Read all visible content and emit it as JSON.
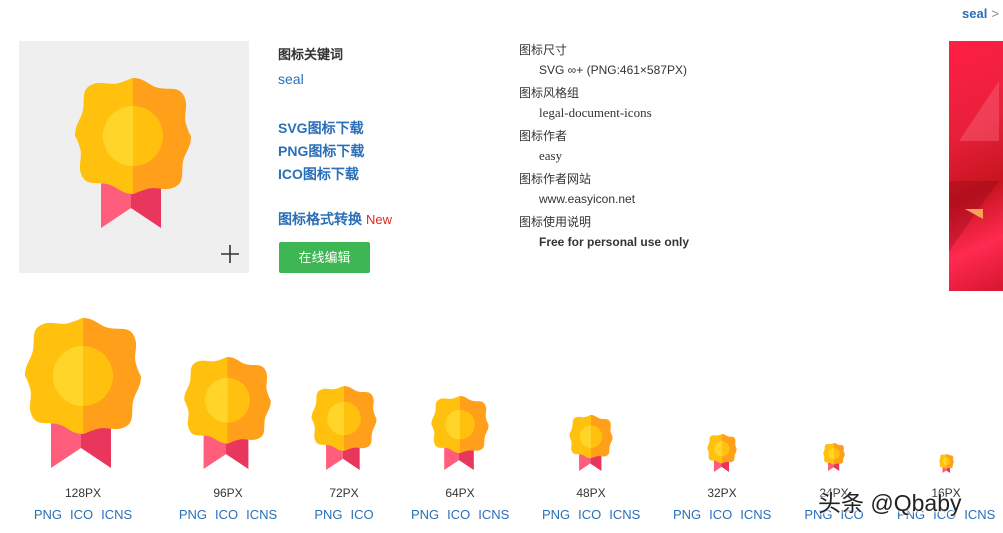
{
  "breadcrumb": {
    "current": "seal",
    "separator": ">"
  },
  "preview": {
    "plus_symbol": "+",
    "icon": "medal-icon"
  },
  "keywords": {
    "label": "图标关键词",
    "value": "seal"
  },
  "downloads": {
    "svg": "SVG图标下载",
    "png": "PNG图标下载",
    "ico": "ICO图标下载"
  },
  "convert": {
    "label": "图标格式转换",
    "badge": "New"
  },
  "edit_button": "在线编辑",
  "info": {
    "size_label": "图标尺寸",
    "size_value": "SVG ∞+ (PNG:461×587PX)",
    "style_label": "图标风格组",
    "style_value": "legal-document-icons",
    "author_label": "图标作者",
    "author_value": "easy",
    "site_label": "图标作者网站",
    "site_value": "www.easyicon.net",
    "usage_label": "图标使用说明",
    "usage_value": "Free for personal use only"
  },
  "sizes": [
    {
      "label": "128PX",
      "links": [
        "PNG",
        "ICO",
        "ICNS"
      ]
    },
    {
      "label": "96PX",
      "links": [
        "PNG",
        "ICO",
        "ICNS"
      ]
    },
    {
      "label": "72PX",
      "links": [
        "PNG",
        "ICO"
      ]
    },
    {
      "label": "64PX",
      "links": [
        "PNG",
        "ICO",
        "ICNS"
      ]
    },
    {
      "label": "48PX",
      "links": [
        "PNG",
        "ICO",
        "ICNS"
      ]
    },
    {
      "label": "32PX",
      "links": [
        "PNG",
        "ICO",
        "ICNS"
      ]
    },
    {
      "label": "24PX",
      "links": [
        "PNG",
        "ICO"
      ]
    },
    {
      "label": "16PX",
      "links": [
        "PNG",
        "ICO",
        "ICNS"
      ]
    }
  ],
  "watermark": "头条 @Qbaby",
  "colors": {
    "link": "#2a6fb8",
    "button": "#3db653",
    "new_badge": "#e0281f",
    "medal_left": "#ffc10e",
    "medal_right": "#ff9f1a",
    "ribbon_left": "#ff5d7c",
    "ribbon_right": "#e8365d"
  }
}
